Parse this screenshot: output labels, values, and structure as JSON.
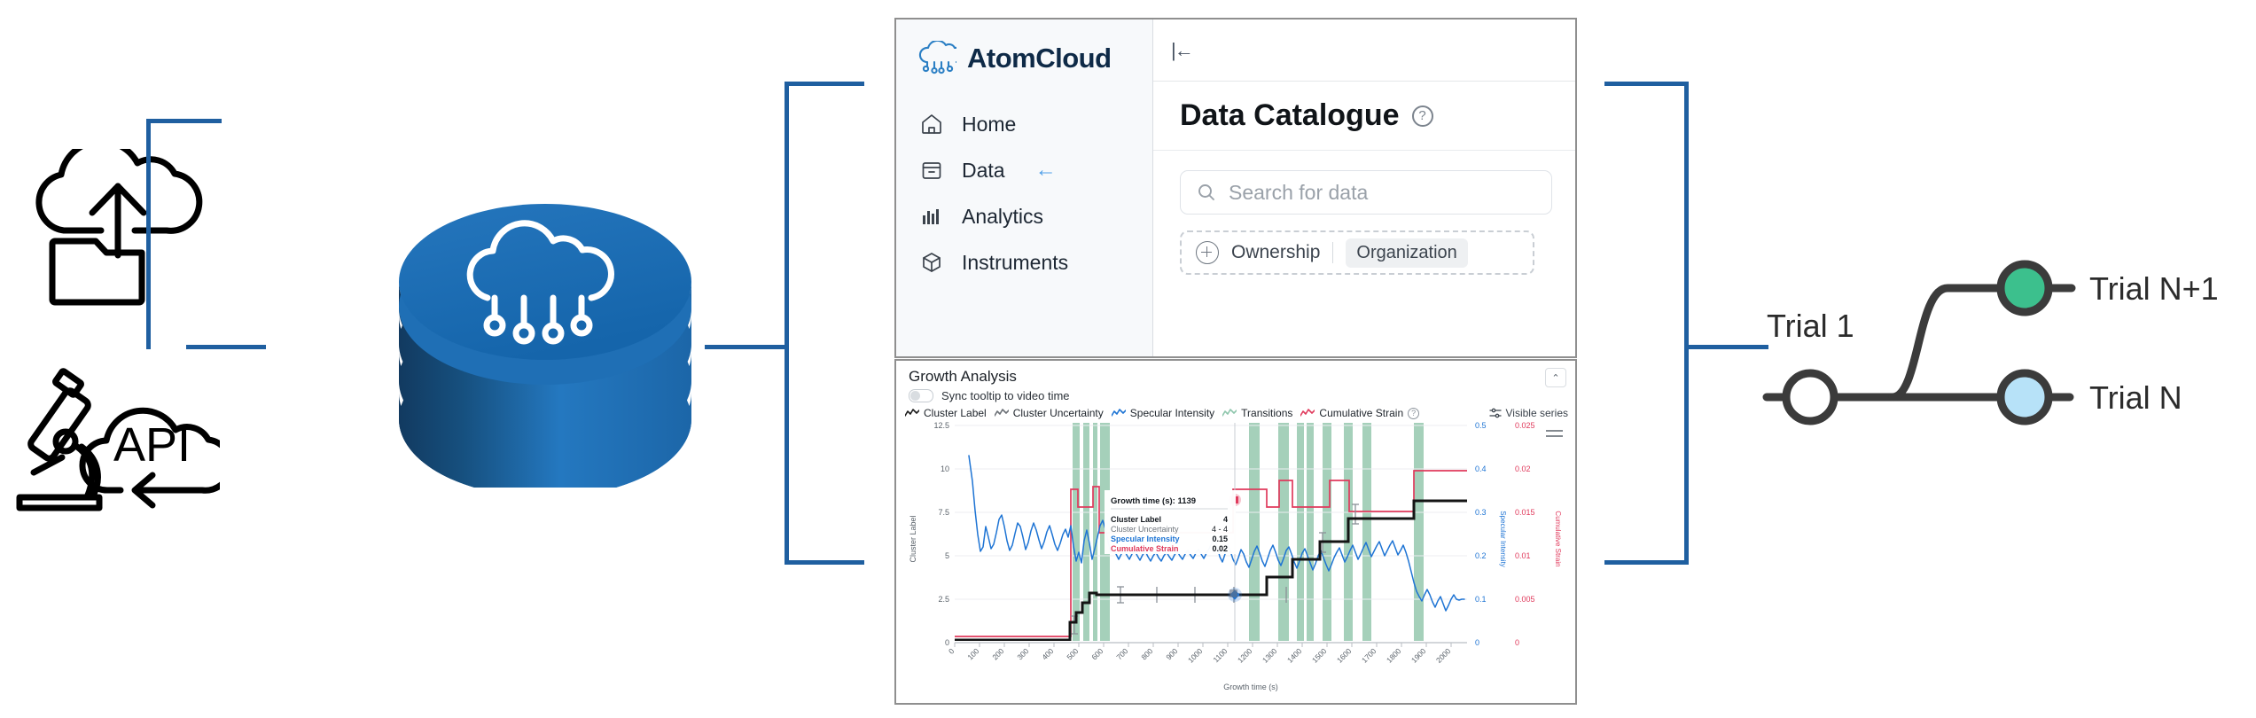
{
  "left_sources": {
    "upload_icon": "cloud-upload-folder-icon",
    "api_icon": "microscope-api-cloud-icon",
    "api_text": "API"
  },
  "database": {
    "icon": "database-cylinder-cloud-icon"
  },
  "app": {
    "brand": {
      "logo": "atomcloud-logo-icon",
      "name": "AtomCloud"
    },
    "topbar": {
      "collapse_icon": "collapse-sidebar-icon",
      "collapse_glyph": "|←"
    },
    "sidebar": {
      "items": [
        {
          "label": "Home",
          "icon": "home-icon",
          "arrow": ""
        },
        {
          "label": "Data",
          "icon": "archive-box-icon",
          "arrow": "←"
        },
        {
          "label": "Analytics",
          "icon": "bar-chart-icon",
          "arrow": ""
        },
        {
          "label": "Instruments",
          "icon": "cube-icon",
          "arrow": ""
        }
      ]
    },
    "page": {
      "title": "Data Catalogue",
      "help_icon": "help-circle-icon",
      "help_glyph": "?",
      "search": {
        "icon": "search-icon",
        "placeholder": "Search for data",
        "value": ""
      },
      "filter": {
        "add_icon": "plus-circle-icon",
        "label": "Ownership",
        "chip": "Organization"
      }
    }
  },
  "chart_panel": {
    "title": "Growth Analysis",
    "collapse_icon": "chevron-up-icon",
    "collapse_glyph": "⌃",
    "sync_toggle": {
      "label": "Sync tooltip to video time",
      "state": "off"
    },
    "visible_series": {
      "icon": "sliders-icon",
      "label": "Visible series"
    },
    "legend": [
      {
        "label": "Cluster Label",
        "color": "#1b1b1b"
      },
      {
        "label": "Cluster Uncertainty",
        "color": "#6b7076"
      },
      {
        "label": "Specular Intensity",
        "color": "#1e74d4"
      },
      {
        "label": "Transitions",
        "color": "#8ec6ac"
      },
      {
        "label": "Cumulative Strain",
        "color": "#e03a5c"
      }
    ],
    "legend_help_icon": "help-circle-icon",
    "tooltip": {
      "header_label": "Growth time (s)",
      "header_value": "1139",
      "rows": [
        {
          "label": "Cluster Label",
          "value": "4",
          "color": "#12171d"
        },
        {
          "label": "Cluster Uncertainty",
          "value": "4 - 4",
          "color": "#6e747b"
        },
        {
          "label": "Specular Intensity",
          "value": "0.15",
          "color": "#1e74d4"
        },
        {
          "label": "Cumulative Strain",
          "value": "0.02",
          "color": "#e03a5c"
        }
      ]
    }
  },
  "chart_data": {
    "type": "line",
    "title": "Growth Analysis",
    "xlabel": "Growth time (s)",
    "xlim": [
      0,
      2080
    ],
    "xticks": [
      0,
      100,
      200,
      300,
      400,
      500,
      600,
      700,
      800,
      900,
      1000,
      1100,
      1200,
      1300,
      1400,
      1500,
      1600,
      1700,
      1800,
      1900,
      2000
    ],
    "grid": true,
    "legend_position": "top",
    "axes": [
      {
        "name": "Cluster Label",
        "side": "left",
        "color": "#5b636b",
        "ylim": [
          0,
          12.5
        ],
        "yticks": [
          0,
          2.5,
          5,
          7.5,
          10,
          12.5
        ]
      },
      {
        "name": "Specular Intensity",
        "side": "right",
        "color": "#1e74d4",
        "ylim": [
          0,
          0.5
        ],
        "yticks": [
          0,
          0.1,
          0.2,
          0.3,
          0.4,
          0.5
        ]
      },
      {
        "name": "Cumulative Strain",
        "side": "right",
        "color": "#e03a5c",
        "ylim": [
          0,
          0.025
        ],
        "yticks": [
          0,
          0.005,
          0.01,
          0.015,
          0.02,
          0.025
        ]
      }
    ],
    "series": [
      {
        "name": "Cluster Label",
        "color": "#1b1b1b",
        "axis": "Cluster Label",
        "style": "step",
        "x": [
          0,
          470,
          495,
          520,
          545,
          570,
          600,
          1180,
          1215,
          1250,
          1285,
          1320,
          1355,
          1560,
          1600,
          2080
        ],
        "y": [
          0,
          0,
          0.6,
          1.2,
          1.8,
          2.6,
          4.0,
          4.0,
          5.0,
          5.8,
          6.6,
          7.4,
          8.6,
          8.6,
          9.6,
          9.6
        ]
      },
      {
        "name": "Cluster Uncertainty",
        "color": "#6b7076",
        "axis": "Cluster Label",
        "style": "error-bars",
        "x": [
          490,
          620,
          720,
          820,
          930,
          1100,
          1300,
          1420
        ],
        "y": [
          1.0,
          4.0,
          4.0,
          4.0,
          4.0,
          4.0,
          6.6,
          8.0
        ],
        "err": [
          0.45,
          0.45,
          0.45,
          0.45,
          0.45,
          0.45,
          0.55,
          0.55
        ]
      },
      {
        "name": "Specular Intensity",
        "color": "#1e74d4",
        "axis": "Specular Intensity",
        "style": "line",
        "note": "oscillating RHEED-like signal, decays from ~0.42 at t≈60 to ~0.10 at t≈2050",
        "x_range": [
          55,
          2050
        ],
        "y_range": [
          0.085,
          0.42
        ]
      },
      {
        "name": "Transitions",
        "color": "#8ec6ac",
        "axis": "Cluster Label",
        "style": "vertical-bands",
        "bands": [
          [
            480,
            495
          ],
          [
            500,
            512
          ],
          [
            518,
            530
          ],
          [
            534,
            552
          ],
          [
            1195,
            1212
          ],
          [
            1255,
            1272
          ],
          [
            1300,
            1314
          ],
          [
            1320,
            1332
          ],
          [
            1352,
            1368
          ],
          [
            1395,
            1412
          ],
          [
            1430,
            1446
          ],
          [
            1700,
            1720
          ]
        ]
      },
      {
        "name": "Cumulative Strain",
        "color": "#e03a5c",
        "axis": "Cumulative Strain",
        "style": "step",
        "x": [
          0,
          470,
          485,
          505,
          520,
          545,
          560,
          1139,
          1200,
          1255,
          1290,
          1320,
          1360,
          1400,
          1430,
          1560,
          1600,
          2080
        ],
        "y": [
          0.0005,
          0.0005,
          0.0175,
          0.0155,
          0.0155,
          0.0178,
          0.0125,
          0.0125,
          0.0195,
          0.0195,
          0.0175,
          0.0215,
          0.019,
          0.019,
          0.0215,
          0.0148,
          0.0225,
          0.0225
        ]
      }
    ]
  },
  "trial_diagram": {
    "start_label": "Trial 1",
    "branch_label": "Trial N+1",
    "main_label": "Trial N",
    "start_node_color": "#ffffff",
    "branch_node_color": "#3cc08d",
    "main_node_color": "#b7e2f8",
    "line_color": "#3b3b3b"
  },
  "connectors": {
    "color": "#1f5fa0"
  }
}
